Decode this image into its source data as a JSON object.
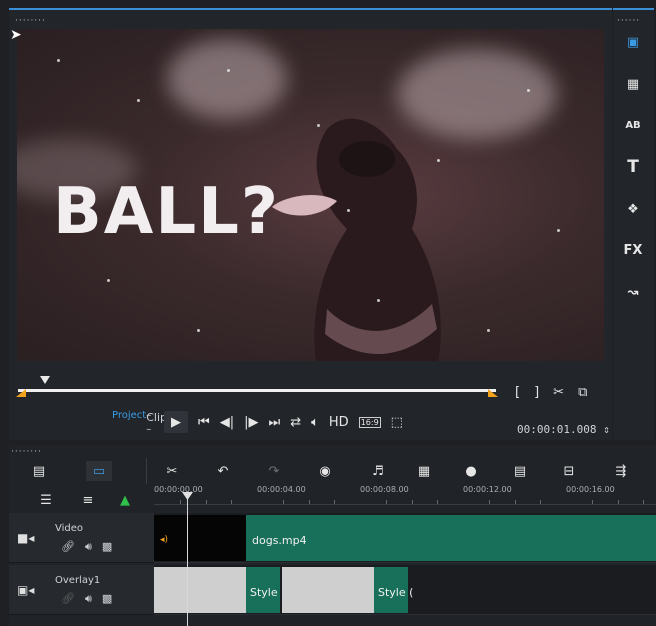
{
  "player": {
    "overlay_text": "BALL?",
    "project_label": "Project",
    "clip_label": "Clip",
    "hd_label": "HD",
    "aspect_label": "16:9",
    "timecode": "00:00:01.008"
  },
  "timeline": {
    "ruler": [
      "00:00:00.00",
      "00:00:04.00",
      "00:00:08.00",
      "00:00:12.00",
      "00:00:16.00"
    ],
    "tracks": [
      {
        "name": "Video",
        "clips": [
          "dogs.mp4"
        ]
      },
      {
        "name": "Overlay1",
        "clips": [
          "Style (",
          "Style ("
        ]
      }
    ]
  },
  "colors": {
    "accent": "#3a9be4",
    "video_clip": "#19705a",
    "marker": "#f0a21a"
  }
}
